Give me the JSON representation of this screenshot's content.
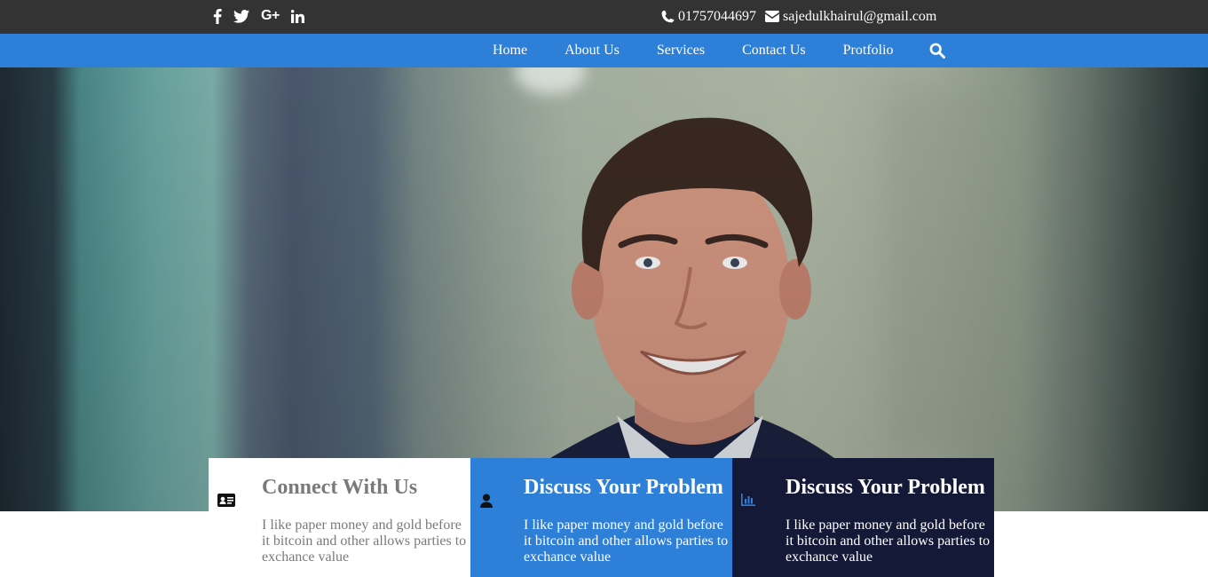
{
  "topbar": {
    "social_icons": [
      "facebook-icon",
      "twitter-icon",
      "google-plus-icon",
      "linkedin-icon"
    ],
    "google_plus_glyph": "G+",
    "phone": "01757044697",
    "email": "sajedulkhairul@gmail.com"
  },
  "nav": {
    "items": [
      "Home",
      "About Us",
      "Services",
      "Contact Us",
      "Protfolio"
    ],
    "search_icon": "search-icon"
  },
  "features": [
    {
      "icon": "id-card-icon",
      "title": "Connect With Us",
      "text": "I like paper money and gold before it bitcoin and other allows parties to exchance value"
    },
    {
      "icon": "user-icon",
      "title": "Discuss Your Problem",
      "text": "I like paper money and gold before it bitcoin and other allows parties to exchance value"
    },
    {
      "icon": "bar-chart-icon",
      "title": "Discuss Your Problem",
      "text": "I like paper money and gold before it bitcoin and other allows parties to exchance value"
    }
  ],
  "colors": {
    "topbar": "#333333",
    "nav": "#2e7fd8",
    "box_white": "#ffffff",
    "box_blue": "#2e7fd8",
    "box_navy": "#141937"
  }
}
